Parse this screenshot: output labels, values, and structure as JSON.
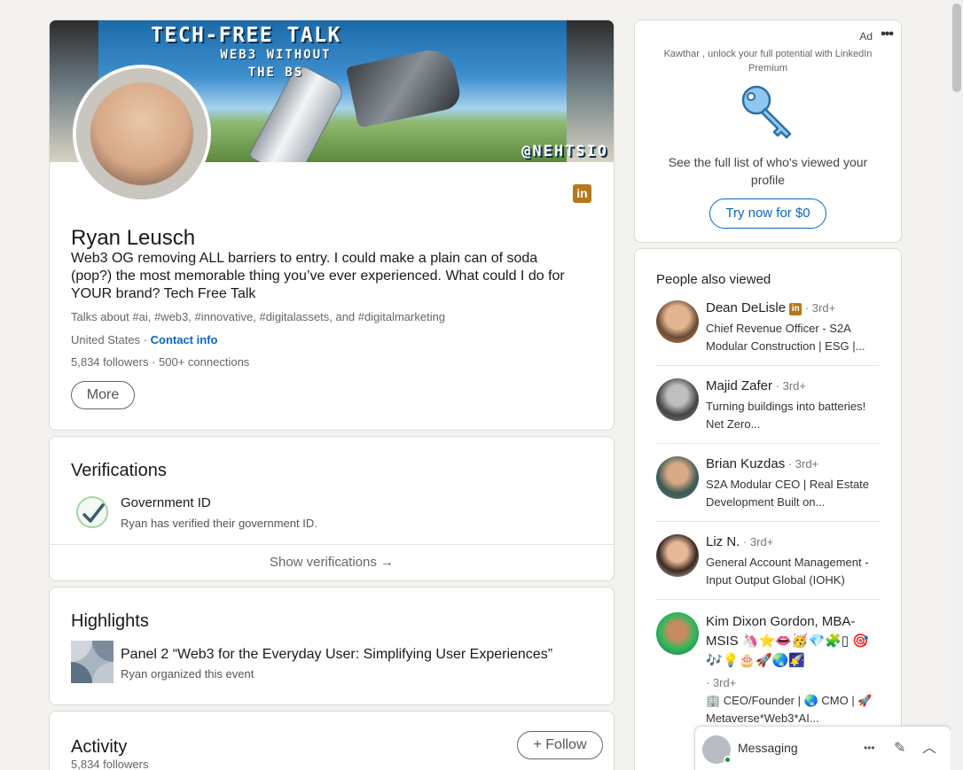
{
  "profile": {
    "banner": {
      "title": "TECH-FREE TALK",
      "subtitle_line1": "WEB3 WITHOUT",
      "subtitle_line2": "THE BS",
      "handle": "@NEHTSIO"
    },
    "name": "Ryan Leusch",
    "headline": "Web3 OG removing ALL barriers to entry. I could make a plain can of soda (pop?) the most memorable thing you’ve ever experienced. What could I do for YOUR brand? Tech Free Talk",
    "talks_about": "Talks about #ai, #web3, #innovative, #digitalassets, and #digitalmarketing",
    "location": "United States",
    "location_sep": " · ",
    "contact_info": "Contact info",
    "followers": "5,834 followers",
    "connections": "500+ connections",
    "more_label": "More",
    "linkedin_badge": "in"
  },
  "verifications": {
    "title": "Verifications",
    "item_title": "Government ID",
    "item_desc": "Ryan has verified their government ID.",
    "show_label": "Show verifications →"
  },
  "highlights": {
    "title": "Highlights",
    "item_title": "Panel 2 “Web3 for the Everyday User: Simplifying User Experiences”",
    "item_sub": "Ryan organized this event"
  },
  "activity": {
    "title": "Activity",
    "followers": "5,834 followers",
    "follow_label": "+ Follow"
  },
  "ad": {
    "label": "Ad",
    "menu": "•••",
    "pitch": "Kawthar , unlock your full potential with LinkedIn Premium",
    "body": "See the full list of who's viewed your profile",
    "cta": "Try now for $0"
  },
  "people_also_viewed": {
    "title": "People also viewed",
    "people": [
      {
        "name": "Dean DeLisle",
        "degree": " · 3rd+",
        "headline": "Chief Revenue Officer - S2A Modular Construction | ESG |...",
        "has_badge": true
      },
      {
        "name": "Majid Zafer",
        "degree": " · 3rd+",
        "headline": "Turning buildings into batteries! Net Zero..."
      },
      {
        "name": "Brian Kuzdas",
        "degree": " · 3rd+",
        "headline": "S2A Modular CEO | Real Estate Development Built on..."
      },
      {
        "name": "Liz N.",
        "degree": " · 3rd+",
        "headline": "General Account Management - Input Output Global (IOHK)"
      },
      {
        "name": "Kim Dixon Gordon, MBA-MSIS",
        "name_emoji_1": "🦄⭐👄🥳💎🧩▯",
        "name_emoji_2": "🎯🎶💡🎂🚀🌏🌠",
        "degree": "· 3rd+",
        "headline": "🏢 CEO/Founder | 🌏 CMO | 🚀 Metaverse*Web3*AI..."
      }
    ]
  },
  "messaging": {
    "label": "Messaging",
    "dots": "•••",
    "compose_icon": "✎",
    "collapse_icon": "︿"
  },
  "colors": {
    "accent": "#0a66c2",
    "premium_gold": "#b5781a",
    "background": "#f3f2ef",
    "online": "#1a8f3e"
  }
}
